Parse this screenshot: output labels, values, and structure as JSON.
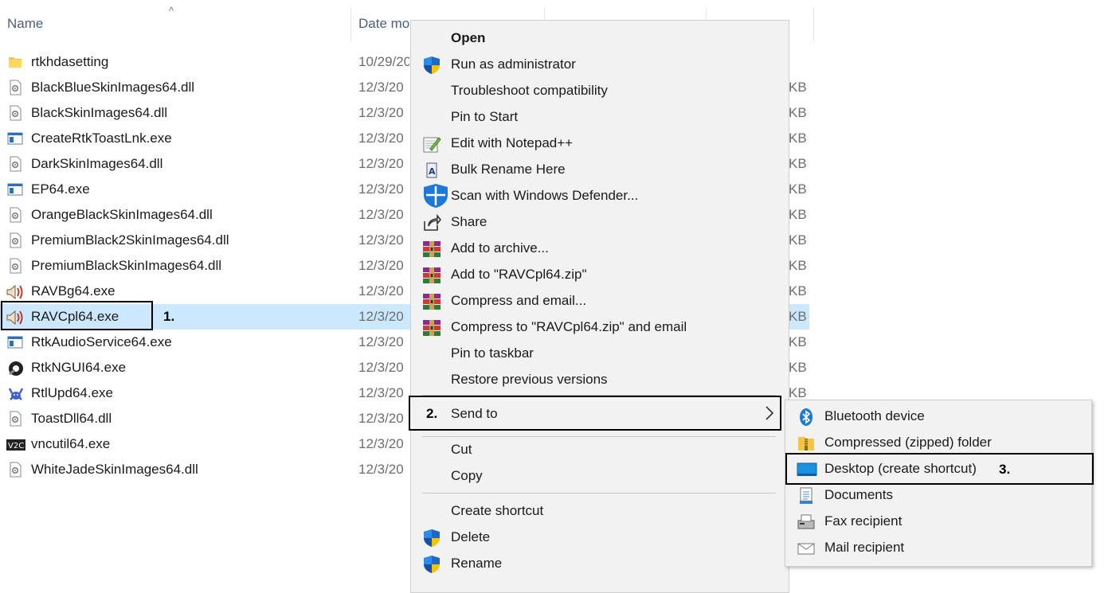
{
  "header": {
    "col_name": "Name",
    "col_date": "Date mo",
    "sort_indicator": "^"
  },
  "files": [
    {
      "name": "rtkhdasetting",
      "date": "10/29/20",
      "size": "",
      "icon": "folder-icon"
    },
    {
      "name": "BlackBlueSkinImages64.dll",
      "date": "12/3/20",
      "size": "KB",
      "icon": "dll-file-icon"
    },
    {
      "name": "BlackSkinImages64.dll",
      "date": "12/3/20",
      "size": "KB",
      "icon": "dll-file-icon"
    },
    {
      "name": "CreateRtkToastLnk.exe",
      "date": "12/3/20",
      "size": "KB",
      "icon": "exe-app-icon"
    },
    {
      "name": "DarkSkinImages64.dll",
      "date": "12/3/20",
      "size": "KB",
      "icon": "dll-file-icon"
    },
    {
      "name": "EP64.exe",
      "date": "12/3/20",
      "size": "KB",
      "icon": "exe-app-icon"
    },
    {
      "name": "OrangeBlackSkinImages64.dll",
      "date": "12/3/20",
      "size": "KB",
      "icon": "dll-file-icon"
    },
    {
      "name": "PremiumBlack2SkinImages64.dll",
      "date": "12/3/20",
      "size": "KB",
      "icon": "dll-file-icon"
    },
    {
      "name": "PremiumBlackSkinImages64.dll",
      "date": "12/3/20",
      "size": "KB",
      "icon": "dll-file-icon"
    },
    {
      "name": "RAVBg64.exe",
      "date": "12/3/20",
      "size": "KB",
      "icon": "speaker-icon"
    },
    {
      "name": "RAVCpl64.exe",
      "date": "12/3/20",
      "size": "KB",
      "icon": "speaker-icon"
    },
    {
      "name": "RtkAudioService64.exe",
      "date": "12/3/20",
      "size": "KB",
      "icon": "exe-app-icon"
    },
    {
      "name": "RtkNGUI64.exe",
      "date": "12/3/20",
      "size": "KB",
      "icon": "realtek-gui-icon"
    },
    {
      "name": "RtlUpd64.exe",
      "date": "12/3/20",
      "size": "KB",
      "icon": "crab-icon"
    },
    {
      "name": "ToastDll64.dll",
      "date": "12/3/20",
      "size": "KB",
      "icon": "dll-file-icon"
    },
    {
      "name": "vncutil64.exe",
      "date": "12/3/20",
      "size": "KB",
      "icon": "vnc-icon"
    },
    {
      "name": "WhiteJadeSkinImages64.dll",
      "date": "12/3/20",
      "size": "",
      "icon": "dll-file-icon"
    }
  ],
  "annotations": {
    "step1": "1.",
    "step2": "2.",
    "step3": "3."
  },
  "context_menu": {
    "items": [
      {
        "label": "Open",
        "icon": "",
        "bold": true
      },
      {
        "label": "Run as administrator",
        "icon": "uac-shield-icon"
      },
      {
        "label": "Troubleshoot compatibility",
        "icon": ""
      },
      {
        "label": "Pin to Start",
        "icon": ""
      },
      {
        "label": "Edit with Notepad++",
        "icon": "notepadpp-icon"
      },
      {
        "label": "Bulk Rename Here",
        "icon": "bulk-rename-icon"
      },
      {
        "label": "Scan with Windows Defender...",
        "icon": "defender-icon"
      },
      {
        "label": "Share",
        "icon": "share-icon"
      },
      {
        "label": "Add to archive...",
        "icon": "winrar-icon"
      },
      {
        "label": "Add to \"RAVCpl64.zip\"",
        "icon": "winrar-icon"
      },
      {
        "label": "Compress and email...",
        "icon": "winrar-icon"
      },
      {
        "label": "Compress to \"RAVCpl64.zip\" and email",
        "icon": "winrar-icon"
      },
      {
        "label": "Pin to taskbar",
        "icon": ""
      },
      {
        "label": "Restore previous versions",
        "icon": ""
      }
    ],
    "send_to": "Send to",
    "chevron": "›",
    "items2": [
      {
        "label": "Cut"
      },
      {
        "label": "Copy"
      }
    ],
    "items3": [
      {
        "label": "Create shortcut",
        "icon": ""
      },
      {
        "label": "Delete",
        "icon": "uac-shield-icon"
      },
      {
        "label": "Rename",
        "icon": "uac-shield-icon"
      }
    ]
  },
  "send_to_menu": {
    "items": [
      {
        "label": "Bluetooth device",
        "icon": "bluetooth-icon"
      },
      {
        "label": "Compressed (zipped) folder",
        "icon": "zip-folder-icon"
      },
      {
        "label": "Desktop (create shortcut)",
        "icon": "desktop-icon"
      },
      {
        "label": "Documents",
        "icon": "documents-icon"
      },
      {
        "label": "Fax recipient",
        "icon": "fax-icon"
      },
      {
        "label": "Mail recipient",
        "icon": "mail-icon"
      }
    ]
  }
}
